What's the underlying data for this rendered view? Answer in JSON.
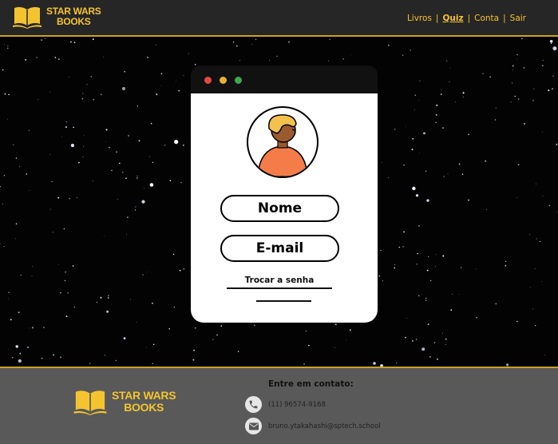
{
  "brand": {
    "line1": "STAR WARS",
    "line2": "BOOKS"
  },
  "nav": {
    "items": [
      {
        "label": "Livros",
        "active": false
      },
      {
        "label": "Quiz",
        "active": true
      },
      {
        "label": "Conta",
        "active": false
      },
      {
        "label": "Sair",
        "active": false
      }
    ],
    "separator": "|"
  },
  "profile_card": {
    "name_label": "Nome",
    "email_label": "E-mail",
    "change_password_label": "Trocar a senha"
  },
  "footer": {
    "contact_title": "Entre em contato:",
    "phone": "(11) 96574-9168",
    "email": "bruno.ytakahashi@sptech.school"
  },
  "colors": {
    "accent": "#f4c430",
    "header_bg": "#262626",
    "footer_bg": "#595959",
    "window_red": "#e04b3c",
    "window_yellow": "#e9b12c",
    "window_green": "#3fa84e",
    "avatar_shirt": "#f47c48",
    "avatar_hair": "#f2c14e"
  },
  "icons": {
    "logo": "open-book-icon",
    "phone": "phone-icon",
    "mail": "mail-icon"
  }
}
